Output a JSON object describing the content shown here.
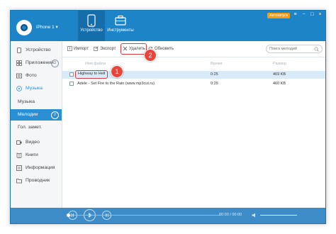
{
  "header": {
    "device_name": "iPhone 1 ▾",
    "tabs": [
      {
        "label": "Устройство",
        "active": true
      },
      {
        "label": "Инструменты",
        "active": false
      }
    ],
    "auto_badge": "Автозапуск",
    "controls": [
      "≡",
      "−",
      "□",
      "×"
    ]
  },
  "sidebar": {
    "items": [
      {
        "label": "Устройство",
        "icon": "phone-icon"
      },
      {
        "label": "Приложения",
        "icon": "apps-icon",
        "count": "3"
      },
      {
        "label": "Фото",
        "icon": "photo-icon"
      },
      {
        "label": "Музыка",
        "icon": "music-icon"
      },
      {
        "label": "Музыка",
        "icon": ""
      },
      {
        "label": "Мелодии",
        "icon": "",
        "count": "2"
      },
      {
        "label": "Гол. замет.",
        "icon": ""
      },
      {
        "label": "Видео",
        "icon": "video-icon"
      },
      {
        "label": "Книги",
        "icon": "book-icon"
      },
      {
        "label": "Информация",
        "icon": "info-icon"
      },
      {
        "label": "Проводник",
        "icon": "folder-icon"
      }
    ]
  },
  "toolbar": {
    "import_label": "Импорт",
    "export_label": "Экспорт",
    "delete_label": "Удалить",
    "refresh_label": "Обновить",
    "search_placeholder": "Поиск мелодий"
  },
  "table": {
    "columns": [
      "Имя файла",
      "Время",
      "Размер"
    ],
    "rows": [
      {
        "title": "Highway to Hell",
        "time": "0:25",
        "size": "469 KB",
        "selected": true
      },
      {
        "title": "Adele - Set Fire to the Rain (www.mp3cut.ru)",
        "time": "0:29",
        "size": "460 KB",
        "selected": false
      }
    ]
  },
  "callouts": [
    "1",
    "2"
  ],
  "player": {
    "time": "00:00 / 00:00",
    "progress": 0
  },
  "colors": {
    "header_blue": "#1d84c8",
    "selected_blue": "#2a8fd3",
    "callout_red": "#e8453c",
    "badge_orange": "#f39c12"
  }
}
